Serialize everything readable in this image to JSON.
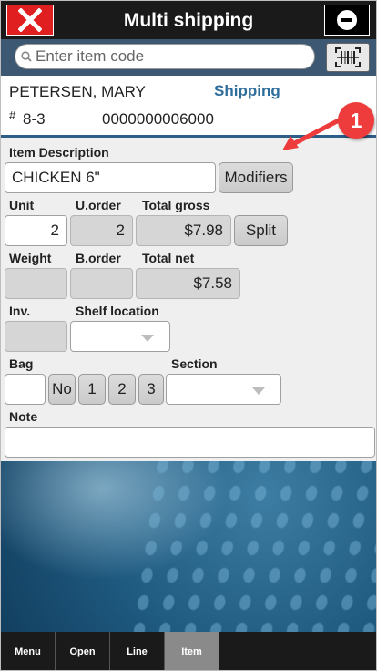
{
  "header": {
    "title": "Multi shipping",
    "close_color": "#e02020"
  },
  "search": {
    "placeholder": "Enter item code",
    "value": ""
  },
  "customer": {
    "name": "PETERSEN, MARY",
    "mode": "Shipping",
    "hash": "#",
    "number": "8-3",
    "code": "0000000006000"
  },
  "callout": {
    "badge": "1"
  },
  "form": {
    "item_description_label": "Item Description",
    "item_description_value": "CHICKEN 6\"",
    "modifiers_label": "Modifiers",
    "unit_label": "Unit",
    "unit_value": "2",
    "uorder_label": "U.order",
    "uorder_value": "2",
    "total_gross_label": "Total gross",
    "total_gross_value": "$7.98",
    "split_label": "Split",
    "weight_label": "Weight",
    "weight_value": "",
    "border_label": "B.order",
    "border_value": "",
    "total_net_label": "Total net",
    "total_net_value": "$7.58",
    "inv_label": "Inv.",
    "inv_value": "",
    "shelf_label": "Shelf location",
    "shelf_value": "",
    "bag_label": "Bag",
    "bag_value": "",
    "bag_buttons": [
      "No",
      "1",
      "2",
      "3"
    ],
    "section_label": "Section",
    "section_value": "",
    "note_label": "Note",
    "note_value": ""
  },
  "nav": {
    "items": [
      "Menu",
      "Open",
      "Line",
      "Item"
    ],
    "active": "Item"
  },
  "colors": {
    "accent_blue": "#3c5873",
    "mode_text": "#2f6e9c",
    "callout_red": "#ee3b3b"
  }
}
